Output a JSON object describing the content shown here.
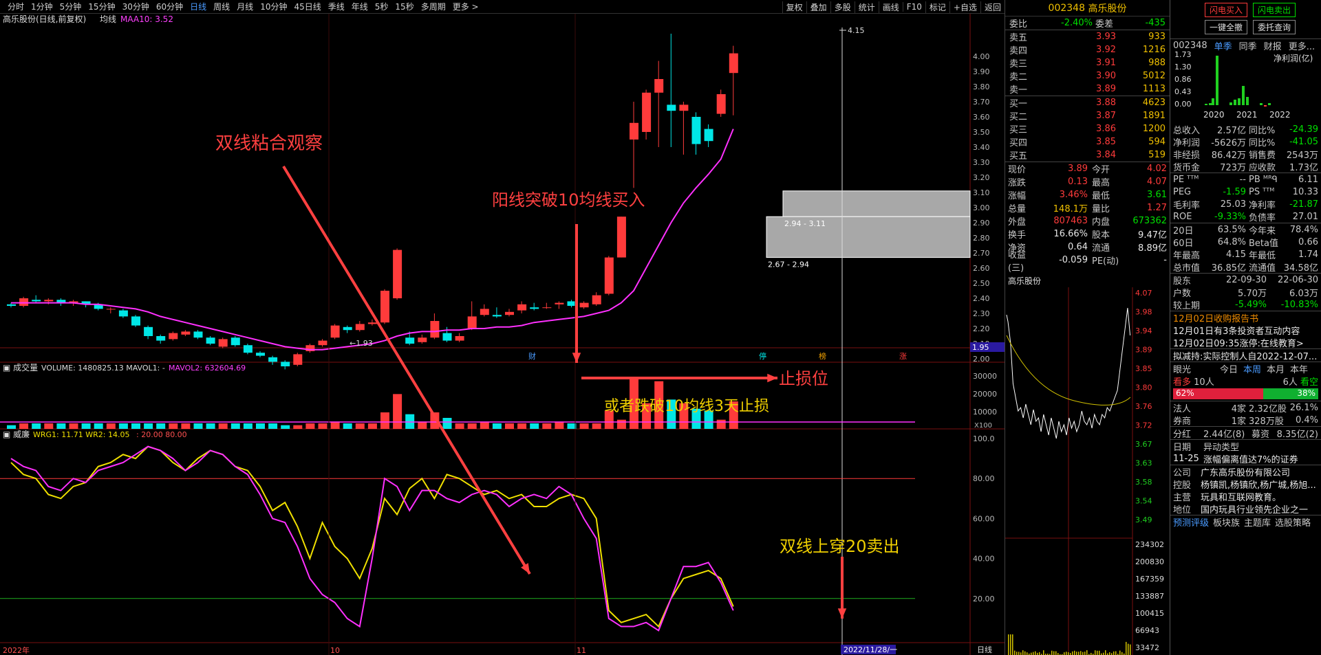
{
  "toolbar": {
    "timeframes": [
      "分时",
      "1分钟",
      "5分钟",
      "15分钟",
      "30分钟",
      "60分钟",
      "日线",
      "周线",
      "月线",
      "10分钟",
      "45日线",
      "季线",
      "年线",
      "5秒",
      "15秒",
      "多周期",
      "更多 >"
    ],
    "active": "日线",
    "right": [
      "复权",
      "叠加",
      "多股",
      "统计",
      "画线",
      "F10",
      "标记",
      "+自选",
      "返回"
    ]
  },
  "chart": {
    "title": "高乐股份(日线,前复权)",
    "ma_label": "均线",
    "ma_value": "MAA10: 3.52",
    "price_axis": [
      "4.00",
      "3.90",
      "3.80",
      "3.70",
      "3.60",
      "3.50",
      "3.40",
      "3.30",
      "3.20",
      "3.10",
      "3.00",
      "2.90",
      "2.80",
      "2.70",
      "2.60",
      "2.50",
      "2.40",
      "2.30",
      "2.20",
      "2.10",
      "2.00"
    ],
    "high_label": "4.15",
    "low_label": "1.93",
    "current_tag": "1.95",
    "gap1": "2.94 - 3.11",
    "gap2": "2.67 - 2.94",
    "event_marks": [
      "财",
      "停",
      "榜",
      "涨"
    ],
    "volume_title": "成交量",
    "volume_values": "VOLUME: 1480825.13  MAVOL1: -",
    "volume_mavol2": "MAVOL2: 632604.69",
    "volume_axis": [
      "30000",
      "20000",
      "10000"
    ],
    "volume_unit": "X100",
    "wr_title": "威廉",
    "wr_values": "WRG1: 11.71  WR2: 14.05",
    "wr_levels": ": 20.00  80.00",
    "wr_axis": [
      "100.0",
      "80.00",
      "60.00",
      "40.00",
      "20.00"
    ],
    "date_start": "2022年",
    "date_oct": "10",
    "date_nov": "11",
    "date_cursor": "2022/11/28/一",
    "period_label": "日线"
  },
  "annotations": {
    "a1": "双线粘合观察",
    "a2": "阳线突破10均线买入",
    "a3": "止损位",
    "a4": "或者跌破10均线3天止损",
    "a5": "双线上穿20卖出"
  },
  "quote": {
    "code": "002348",
    "name": "高乐股份",
    "weibi_label": "委比",
    "weibi": "-2.40%",
    "weicha_label": "委差",
    "weicha": "-435",
    "asks": [
      {
        "label": "卖五",
        "price": "3.93",
        "vol": "933"
      },
      {
        "label": "卖四",
        "price": "3.92",
        "vol": "1216"
      },
      {
        "label": "卖三",
        "price": "3.91",
        "vol": "988"
      },
      {
        "label": "卖二",
        "price": "3.90",
        "vol": "5012"
      },
      {
        "label": "卖一",
        "price": "3.89",
        "vol": "1113"
      }
    ],
    "bids": [
      {
        "label": "买一",
        "price": "3.88",
        "vol": "4623"
      },
      {
        "label": "买二",
        "price": "3.87",
        "vol": "1891"
      },
      {
        "label": "买三",
        "price": "3.86",
        "vol": "1200"
      },
      {
        "label": "买四",
        "price": "3.85",
        "vol": "594"
      },
      {
        "label": "买五",
        "price": "3.84",
        "vol": "519"
      }
    ],
    "stats": [
      {
        "k": "现价",
        "v": "3.89",
        "vc": "red",
        "k2": "今开",
        "v2": "4.02",
        "v2c": "red"
      },
      {
        "k": "涨跌",
        "v": "0.13",
        "vc": "red",
        "k2": "最高",
        "v2": "4.07",
        "v2c": "red"
      },
      {
        "k": "涨幅",
        "v": "3.46%",
        "vc": "red",
        "k2": "最低",
        "v2": "3.61",
        "v2c": "green"
      },
      {
        "k": "总量",
        "v": "148.1万",
        "vc": "yellow",
        "k2": "量比",
        "v2": "1.27",
        "v2c": "red"
      },
      {
        "k": "外盘",
        "v": "807463",
        "vc": "red",
        "k2": "内盘",
        "v2": "673362",
        "v2c": "green"
      },
      {
        "k": "换手",
        "v": "16.66%",
        "vc": "white",
        "k2": "股本",
        "v2": "9.47亿",
        "v2c": "white"
      },
      {
        "k": "净资",
        "v": "0.64",
        "vc": "white",
        "k2": "流通",
        "v2": "8.89亿",
        "v2c": "white"
      },
      {
        "k": "收益(三)",
        "v": "-0.059",
        "vc": "white",
        "k2": "PE(动)",
        "v2": "-",
        "v2c": "white"
      }
    ]
  },
  "mini": {
    "title": "高乐股份",
    "axis_left": [
      "4.07",
      "3.98",
      "3.94",
      "3.89",
      "3.85",
      "3.80",
      "3.76",
      "3.72",
      "3.67",
      "3.63",
      "3.58",
      "3.54",
      "3.49"
    ],
    "axis_vol": [
      "234302",
      "200830",
      "167359",
      "133887",
      "100415",
      "66943",
      "33472"
    ]
  },
  "info": {
    "btn_sell_flash": "闪电买入",
    "btn_buy_flash": "闪电卖出",
    "btn_cancel_all": "一键全撤",
    "btn_query": "委托查询",
    "code": "002348",
    "tabs": [
      "单季",
      "同季",
      "财报",
      "更多..."
    ],
    "chart_label": "净利润(亿)",
    "bar_axis": [
      "1.73",
      "1.30",
      "0.86",
      "0.43",
      "0.00"
    ],
    "years": [
      "2020",
      "2021",
      "2022"
    ],
    "fin": [
      {
        "k": "总收入",
        "v": "2.57亿",
        "k2": "同比%",
        "v2": "-24.39"
      },
      {
        "k": "净利润",
        "v": "-5626万",
        "k2": "同比%",
        "v2": "-41.05"
      },
      {
        "k": "非经损",
        "v": "86.42万",
        "k2": "销售费",
        "v2": "2543万"
      },
      {
        "k": "货币金",
        "v": "723万",
        "k2": "应收款",
        "v2": "1.73亿"
      }
    ],
    "val": [
      {
        "k": "PE ᵀᵀᴹ",
        "v": "--",
        "k2": "PB ᴹᴿᑫ",
        "v2": "6.11"
      },
      {
        "k": "PEG",
        "v": "-1.59",
        "k2": "PS ᵀᵀᴹ",
        "v2": "10.33"
      },
      {
        "k": "毛利率",
        "v": "25.03",
        "k2": "净利率",
        "v2": "-21.87"
      },
      {
        "k": "ROE",
        "v": "-9.33%",
        "k2": "负债率",
        "v2": "27.01"
      }
    ],
    "perf": [
      {
        "k": "20日",
        "v": "63.5%",
        "k2": "今年来",
        "v2": "78.4%"
      },
      {
        "k": "60日",
        "v": "64.8%",
        "k2": "Beta值",
        "v2": "0.66"
      },
      {
        "k": "年最高",
        "v": "4.15",
        "k2": "年最低",
        "v2": "1.74"
      },
      {
        "k": "总市值",
        "v": "36.85亿",
        "k2": "流通值",
        "v2": "34.58亿"
      }
    ],
    "holders": [
      {
        "k": "股东",
        "v": "22-09-30",
        "v2": "22-06-30"
      },
      {
        "k": "户数",
        "v": "5.70万",
        "v2": "6.03万"
      },
      {
        "k": "较上期",
        "v": "-5.49%",
        "v2": "-10.83%"
      }
    ],
    "news1": "12月02日收购报告书",
    "news2": "12月01日有3条投资者互动内容",
    "news3": "12月02日09:35涨停:在线教育>",
    "news4": "拟减持:实际控制人自2022-12-07...",
    "eye_label": "眼光",
    "eye_tabs": [
      "今日",
      "本周",
      "本月",
      "本年"
    ],
    "bull_label": "看多",
    "bull_count": "10人",
    "bear_count": "6人",
    "bear_label": "看空",
    "bull_pct": "62%",
    "bear_pct": "38%",
    "inst": [
      {
        "k": "法人",
        "v": "4家",
        "k2": "2.32亿股",
        "v2": "26.1%"
      },
      {
        "k": "券商",
        "v": "1家",
        "k2": "328万股",
        "v2": "0.4%"
      }
    ],
    "dividend": {
      "k": "分红",
      "v": "2.44亿(8)",
      "k2": "募资",
      "v2": "8.35亿(2)"
    },
    "anomaly_head": {
      "k": "日期",
      "v": "异动类型"
    },
    "anomaly": {
      "k": "11-25",
      "v": "涨幅偏离值达7%的证券"
    },
    "company": [
      {
        "k": "公司",
        "v": "广东高乐股份有限公司"
      },
      {
        "k": "控股",
        "v": "杨镇凯,杨镇欣,杨广城,杨旭..."
      },
      {
        "k": "主营",
        "v": "玩具和互联网教育。"
      },
      {
        "k": "地位",
        "v": "国内玩具行业领先企业之一"
      }
    ],
    "bottom_tabs": [
      "预测评级",
      "板块族",
      "主题库",
      "选股策略"
    ]
  }
}
